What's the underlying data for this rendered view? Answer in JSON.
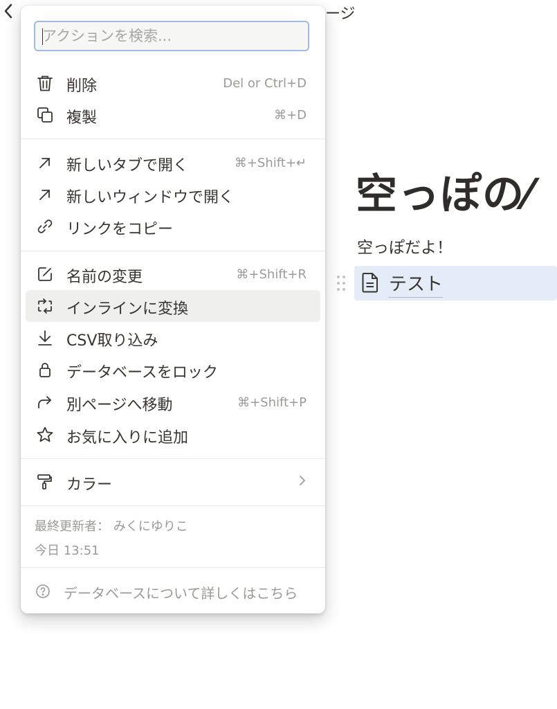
{
  "topbar": {
    "back_icon": "chevron-left-icon",
    "breadcrumb_tail": "ージ"
  },
  "page": {
    "title": "空っぽの⁄",
    "text": "空っぽだよ！",
    "row": {
      "label": "テスト",
      "icon": "page-icon"
    }
  },
  "menu": {
    "search": {
      "placeholder": "アクションを検索...",
      "value": ""
    },
    "items": [
      {
        "label": "削除",
        "shortcut": "Del or Ctrl+D",
        "icon": "trash-icon"
      },
      {
        "label": "複製",
        "shortcut": "⌘+D",
        "icon": "duplicate-icon"
      },
      {
        "label": "新しいタブで開く",
        "shortcut": "⌘+Shift+↵",
        "icon": "arrow-up-right-icon"
      },
      {
        "label": "新しいウィンドウで開く",
        "shortcut": "",
        "icon": "arrow-up-right-icon"
      },
      {
        "label": "リンクをコピー",
        "shortcut": "",
        "icon": "link-icon"
      },
      {
        "label": "名前の変更",
        "shortcut": "⌘+Shift+R",
        "icon": "edit-icon"
      },
      {
        "label": "インラインに変換",
        "shortcut": "",
        "icon": "convert-icon",
        "highlighted": true
      },
      {
        "label": "CSV取り込み",
        "shortcut": "",
        "icon": "download-arrow-icon"
      },
      {
        "label": "データベースをロック",
        "shortcut": "",
        "icon": "lock-icon"
      },
      {
        "label": "別ページへ移動",
        "shortcut": "⌘+Shift+P",
        "icon": "move-arrow-icon"
      },
      {
        "label": "お気に入りに追加",
        "shortcut": "",
        "icon": "star-icon"
      },
      {
        "label": "カラー",
        "shortcut": "",
        "icon": "paint-roller-icon",
        "submenu": true
      }
    ],
    "meta": {
      "last_edited": "最終更新者： みくにゆりこ",
      "time": "今日 13:51"
    },
    "help": {
      "label": "データベースについて詳しくはこちら",
      "icon": "question-circle-icon"
    }
  }
}
